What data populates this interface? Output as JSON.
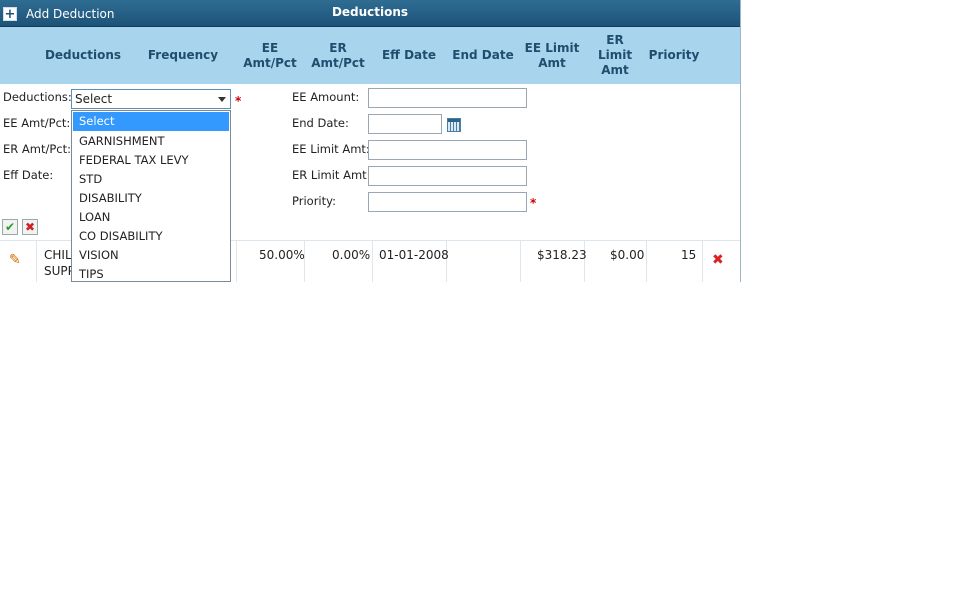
{
  "titlebar": {
    "add_label": "Add Deduction",
    "title": "Deductions"
  },
  "columns": [
    "Deductions",
    "Frequency",
    "EE\nAmt/Pct",
    "ER\nAmt/Pct",
    "Eff Date",
    "End Date",
    "EE Limit\nAmt",
    "ER\nLimit\nAmt",
    "Priority"
  ],
  "form": {
    "deductions_label": "Deductions:",
    "ee_amt_label": "EE Amt/Pct:",
    "er_amt_label": "ER Amt/Pct:",
    "eff_date_label": "Eff Date:",
    "ee_amount_label": "EE Amount:",
    "end_date_label": "End Date:",
    "ee_limit_label": "EE Limit Amt:",
    "er_limit_label": "ER Limit Amt:",
    "priority_label": "Priority:",
    "select_value": "Select",
    "required_mark": "*"
  },
  "dropdown_options": [
    "Select",
    "GARNISHMENT",
    "FEDERAL TAX LEVY",
    "STD",
    "DISABILITY",
    "LOAN",
    "CO DISABILITY",
    "VISION",
    "TIPS"
  ],
  "actions": {
    "save_glyph": "✔",
    "cancel_glyph": "✖"
  },
  "row": {
    "deduction_line1": "CHIL",
    "deduction_line2": "SUPP",
    "ee_amt": "50.00%",
    "er_amt": "0.00%",
    "eff_date": "01-01-2008",
    "end_date": "",
    "ee_limit": "$318.23",
    "er_limit": "$0.00",
    "priority": "15",
    "edit_glyph": "✎",
    "delete_glyph": "✖"
  },
  "colors": {
    "header_bg": "#a9d4ee",
    "titlebar_bg": "#1d5378",
    "selection": "#3399ff",
    "required": "#cc0000"
  },
  "icons": [
    "plus-icon",
    "calendar-icon",
    "check-icon",
    "close-icon",
    "pencil-icon",
    "delete-icon",
    "chevron-down-icon"
  ]
}
